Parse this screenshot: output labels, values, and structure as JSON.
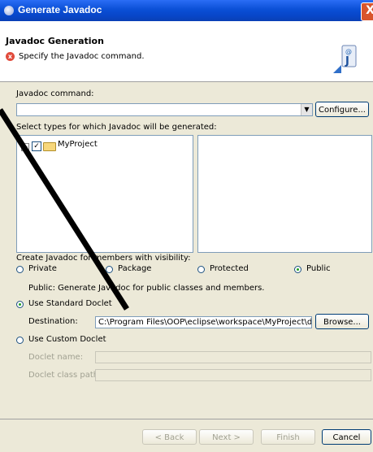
{
  "window": {
    "title": "Generate Javadoc",
    "close_glyph": "X"
  },
  "header": {
    "title": "Javadoc Generation",
    "message": "Specify the Javadoc command.",
    "error_glyph": "x",
    "banner_icon": "javadoc-wizard-icon"
  },
  "javadoc_command": {
    "label": "Javadoc command:",
    "value": "",
    "configure_label": "Configure..."
  },
  "types": {
    "label": "Select types for which Javadoc will be generated:",
    "tree": [
      {
        "label": "MyProject",
        "expander": "+",
        "checked": true
      }
    ]
  },
  "visibility": {
    "label": "Create Javadoc for members with visibility:",
    "options": [
      {
        "label": "Private",
        "selected": false
      },
      {
        "label": "Package",
        "selected": false
      },
      {
        "label": "Protected",
        "selected": false
      },
      {
        "label": "Public",
        "selected": true
      }
    ],
    "description": "Public: Generate Javadoc for public classes and members."
  },
  "doclet": {
    "standard_label": "Use Standard Doclet",
    "standard_selected": true,
    "destination_label": "Destination:",
    "destination_value": "C:\\Program Files\\OOP\\eclipse\\workspace\\MyProject\\doc",
    "browse_label": "Browse...",
    "custom_label": "Use Custom Doclet",
    "custom_selected": false,
    "doclet_name_label": "Doclet name:",
    "doclet_classpath_label": "Doclet class path:"
  },
  "footer": {
    "back": "< Back",
    "next": "Next >",
    "finish": "Finish",
    "cancel": "Cancel"
  },
  "colors": {
    "titlebar": "#0a4fd6",
    "dialog": "#ece9d8",
    "error": "#e14b3c",
    "annotation_slash": "#000000"
  }
}
